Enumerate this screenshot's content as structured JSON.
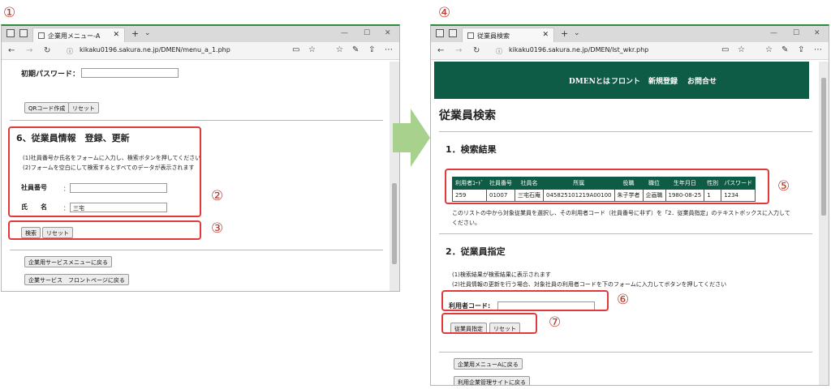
{
  "markers": {
    "m1": "①",
    "m2": "②",
    "m3": "③",
    "m4": "④",
    "m5": "⑤",
    "m6": "⑥",
    "m7": "⑦"
  },
  "left_window": {
    "tab_title": "企業用メニュー-A",
    "url": "kikaku0196.sakura.ne.jp/DMEN/menu_a_1.php",
    "initial_password_label": "初期パスワード：",
    "qr_button": "QRコード作成",
    "reset_button": "リセット",
    "section_title": "6、従業員情報　登録、更新",
    "instruction_1": "(1)社員番号か氏名をフォームに入力し、検索ボタンを押してください",
    "instruction_2": "(2)フォームを空白にして検索するとすべてのデータが表示されます",
    "employee_no_label": "社員番号",
    "employee_no_colon": "：",
    "name_label": "氏　　名",
    "name_colon": "：",
    "name_value": "三宅",
    "search_button": "検索",
    "reset_button_2": "リセット",
    "back_service_menu": "企業用サービスメニューに戻る",
    "back_front_page": "企業サービス　フロントページに戻る"
  },
  "right_window": {
    "tab_title": "従業員検索",
    "url": "kikaku0196.sakura.ne.jp/DMEN/lst_wkr.php",
    "nav": [
      "DMENとは",
      "フロント",
      "新規登録",
      "お問合せ"
    ],
    "page_title": "従業員検索",
    "section1_title": "1．検索結果",
    "table_headers": [
      "利用者ｺｰﾄﾞ",
      "社員番号",
      "社員名",
      "所属",
      "役職",
      "職位",
      "生年月日",
      "性別",
      "パスワード"
    ],
    "table_row": [
      "259",
      "01007",
      "三宅石庵",
      "045825101219A00100",
      "朱子学者",
      "企画職",
      "1980-08-25",
      "1",
      "1234"
    ],
    "note_line_1": "このリストの中から対象従業員を選択し、その利用者コード（社員番号に非ず）を「2．従業員指定」のテキストボックスに入力して",
    "note_line_2": "ください。",
    "section2_title": "2．従業員指定",
    "instruction_1": "(1)検索結果が検索結果に表示されます",
    "instruction_2": "(2)社員情報の更新を行う場合、対象社員の利用者コードを下のフォームに入力してボタンを押してください",
    "user_code_label": "利用者コード:",
    "specify_button": "従業員指定",
    "reset_button": "リセット",
    "back_menu_a": "企業用メニューAに戻る",
    "back_admin_site": "利用企業管理サイトに戻る"
  },
  "colors": {
    "accent_green": "#0e5c46",
    "annotation_red": "#e23a3a",
    "arrow_green": "#a9d18e"
  }
}
